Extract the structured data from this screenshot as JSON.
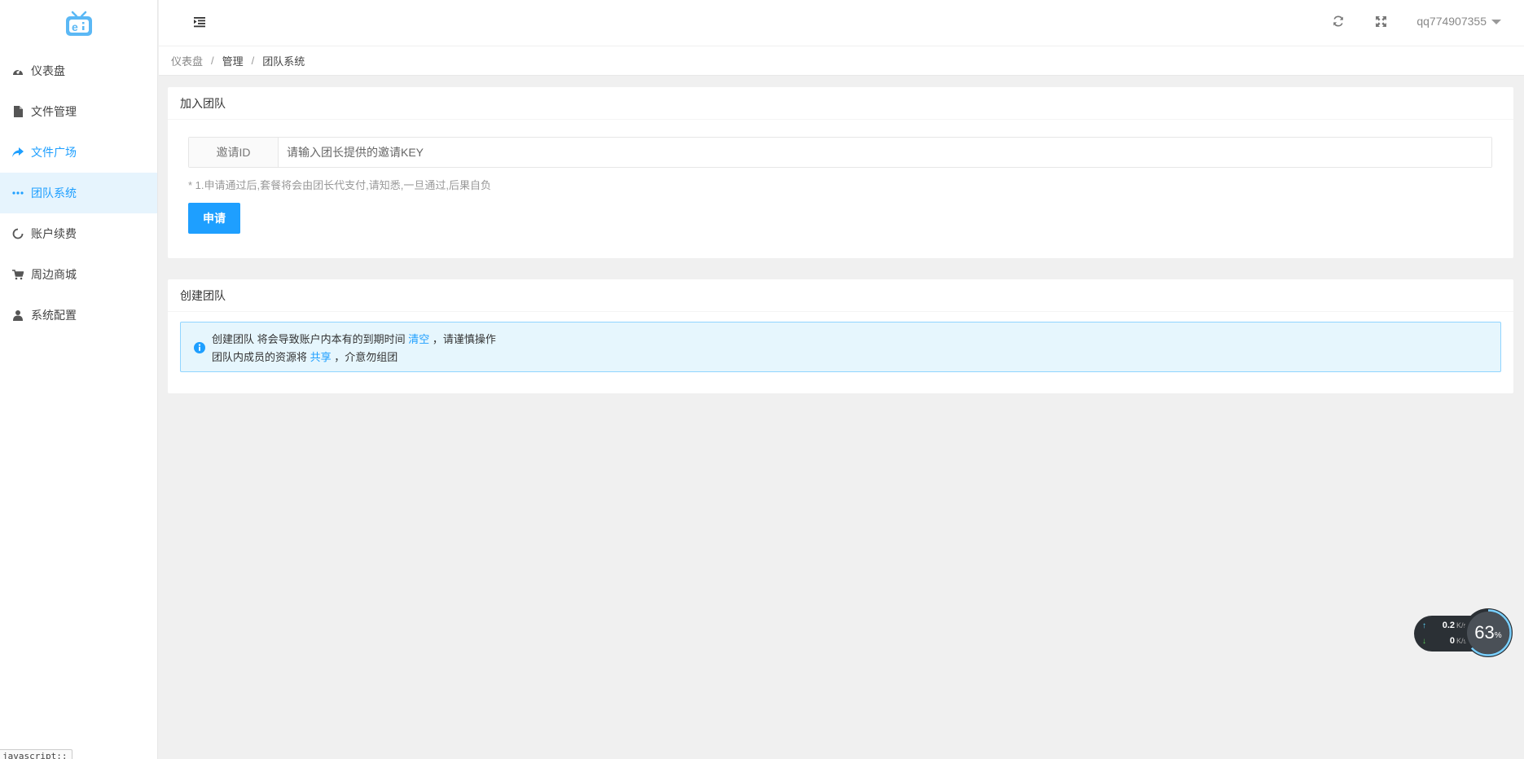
{
  "sidebar": {
    "logo_icon": "tv-logo-icon",
    "items": [
      {
        "label": "仪表盘",
        "icon": "dashboard-icon",
        "active": false
      },
      {
        "label": "文件管理",
        "icon": "file-icon",
        "active": false
      },
      {
        "label": "文件广场",
        "icon": "share-icon",
        "active": false
      },
      {
        "label": "团队系统",
        "icon": "more-dots-icon",
        "active": true
      },
      {
        "label": "账户续费",
        "icon": "circle-refresh-icon",
        "active": false
      },
      {
        "label": "周边商城",
        "icon": "cart-icon",
        "active": false
      },
      {
        "label": "系统配置",
        "icon": "user-icon",
        "active": false
      }
    ],
    "status_tip": "javascript:;"
  },
  "header": {
    "username": "qq774907355",
    "refresh_icon": "refresh-icon",
    "fullscreen_icon": "fullscreen-icon"
  },
  "breadcrumb": [
    "仪表盘",
    "管理",
    "团队系统"
  ],
  "join_team": {
    "title": "加入团队",
    "input_label": "邀请ID",
    "input_placeholder": "请输入团长提供的邀请KEY",
    "hint": "* 1.申请通过后,套餐将会由团长代支付,请知悉,一旦通过,后果自负",
    "apply_button": "申请"
  },
  "create_team": {
    "title": "创建团队",
    "line1_prefix": "创建团队 将会导致账户内本有的到期时间 ",
    "line1_highlight": "清空",
    "line1_suffix": " ，请谨慎操作",
    "line2_prefix": "团队内成员的资源将 ",
    "line2_highlight": "共享",
    "line2_suffix": " ，介意勿组团"
  },
  "net_monitor": {
    "upload_value": "0.2",
    "upload_unit": "K/s",
    "download_value": "0",
    "download_unit": "K/s",
    "percent": "63",
    "percent_unit": "%"
  },
  "colors": {
    "accent": "#1e9fff",
    "active_bg": "#e6f4fd",
    "alert_bg": "#e6f6fd",
    "alert_border": "#91d5ff"
  }
}
